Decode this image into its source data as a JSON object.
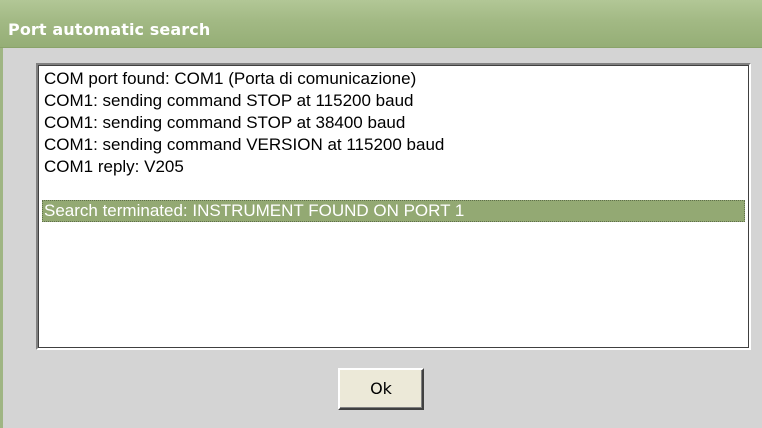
{
  "window": {
    "title": "Port automatic search"
  },
  "log": {
    "items": [
      {
        "text": "COM port found: COM1 (Porta di comunicazione)",
        "selected": false
      },
      {
        "text": "COM1: sending command STOP at 115200 baud",
        "selected": false
      },
      {
        "text": "COM1: sending command STOP at 38400 baud",
        "selected": false
      },
      {
        "text": "COM1: sending command VERSION at 115200 baud",
        "selected": false
      },
      {
        "text": "COM1 reply: V205",
        "selected": false
      },
      {
        "text": "",
        "selected": false
      },
      {
        "text": "Search terminated: INSTRUMENT FOUND ON PORT 1",
        "selected": true
      }
    ]
  },
  "buttons": {
    "ok_label": "Ok"
  },
  "colors": {
    "titlebar": "#a2b984",
    "selection": "#93a973",
    "dialog_bg": "#d4d4d4"
  }
}
